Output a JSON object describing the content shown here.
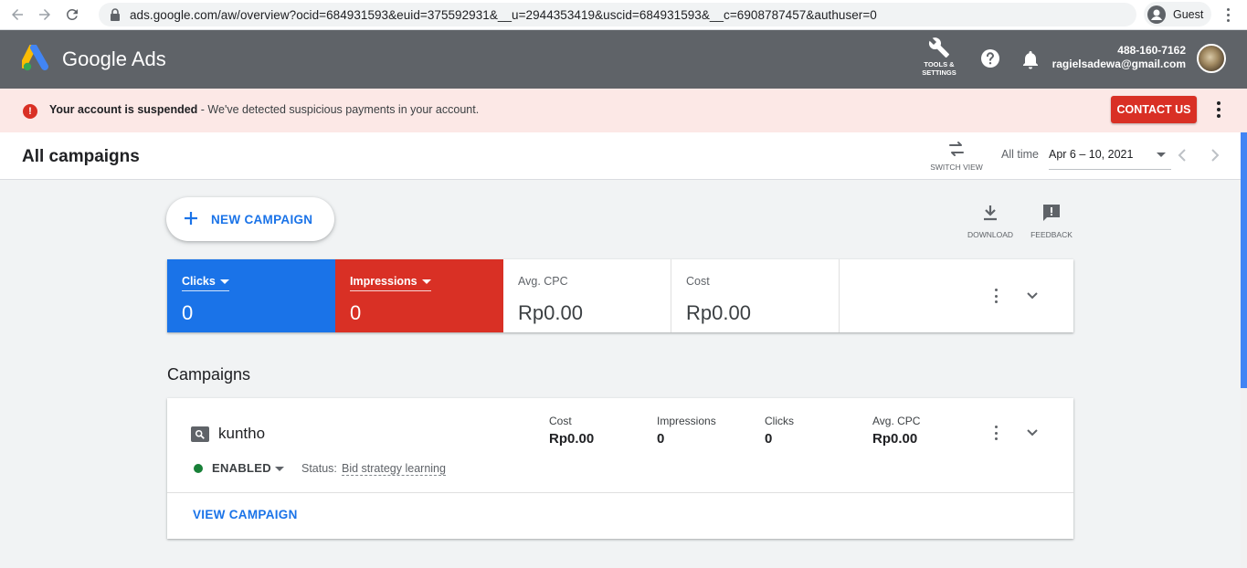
{
  "browser": {
    "url": "ads.google.com/aw/overview?ocid=684931593&euid=375592931&__u=2944353419&uscid=684931593&__c=6908787457&authuser=0",
    "profile_label": "Guest"
  },
  "header": {
    "app_title": "Google Ads",
    "tools_label_line1": "TOOLS &",
    "tools_label_line2": "SETTINGS",
    "account_id": "488-160-7162",
    "account_email": "ragielsadewa@gmail.com",
    "colors": {
      "bar": "#5f6368"
    }
  },
  "banner": {
    "icon": "!",
    "title": "Your account is suspended",
    "message": " - We've detected suspicious payments in your account.",
    "button_label": "CONTACT US",
    "colors": {
      "background": "#fce8e6",
      "button": "#d93025"
    }
  },
  "page": {
    "title": "All campaigns",
    "switch_view_label": "SWITCH VIEW",
    "range_label": "All time",
    "date_range": "Apr 6 – 10, 2021"
  },
  "actions": {
    "new_campaign_label": "NEW CAMPAIGN",
    "download_label": "DOWNLOAD",
    "feedback_label": "FEEDBACK"
  },
  "scorecards": [
    {
      "label": "Clicks",
      "value": "0",
      "color": "#1a73e8"
    },
    {
      "label": "Impressions",
      "value": "0",
      "color": "#d93025"
    },
    {
      "label": "Avg. CPC",
      "value": "Rp0.00"
    },
    {
      "label": "Cost",
      "value": "Rp0.00"
    }
  ],
  "campaigns": {
    "section_title": "Campaigns",
    "items": [
      {
        "name": "kuntho",
        "stats": [
          {
            "label": "Cost",
            "value": "Rp0.00"
          },
          {
            "label": "Impressions",
            "value": "0"
          },
          {
            "label": "Clicks",
            "value": "0"
          },
          {
            "label": "Avg. CPC",
            "value": "Rp0.00"
          }
        ],
        "state": "ENABLED",
        "status_label": "Status:",
        "status_value": "Bid strategy learning",
        "view_label": "VIEW CAMPAIGN"
      }
    ]
  }
}
